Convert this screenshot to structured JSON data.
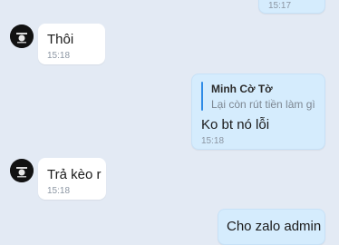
{
  "messages": [
    {
      "direction": "outgoing",
      "time": "15:17"
    },
    {
      "direction": "incoming",
      "text": "Thôi",
      "time": "15:18",
      "avatar_icon": "avatar-icon"
    },
    {
      "direction": "outgoing",
      "reply_to": {
        "name": "Minh Cờ Tờ",
        "text": "Lại còn rút tiền làm gì"
      },
      "text": "Ko bt nó lỗi",
      "time": "15:18"
    },
    {
      "direction": "incoming",
      "text": "Trả kèo r",
      "time": "15:18",
      "avatar_icon": "avatar-icon"
    },
    {
      "direction": "outgoing",
      "text": "Cho zalo admin"
    }
  ],
  "colors": {
    "background": "#e3eaf4",
    "incoming_bubble": "#ffffff",
    "outgoing_bubble": "#d5ecfd",
    "quote_accent": "#2e8be6"
  }
}
